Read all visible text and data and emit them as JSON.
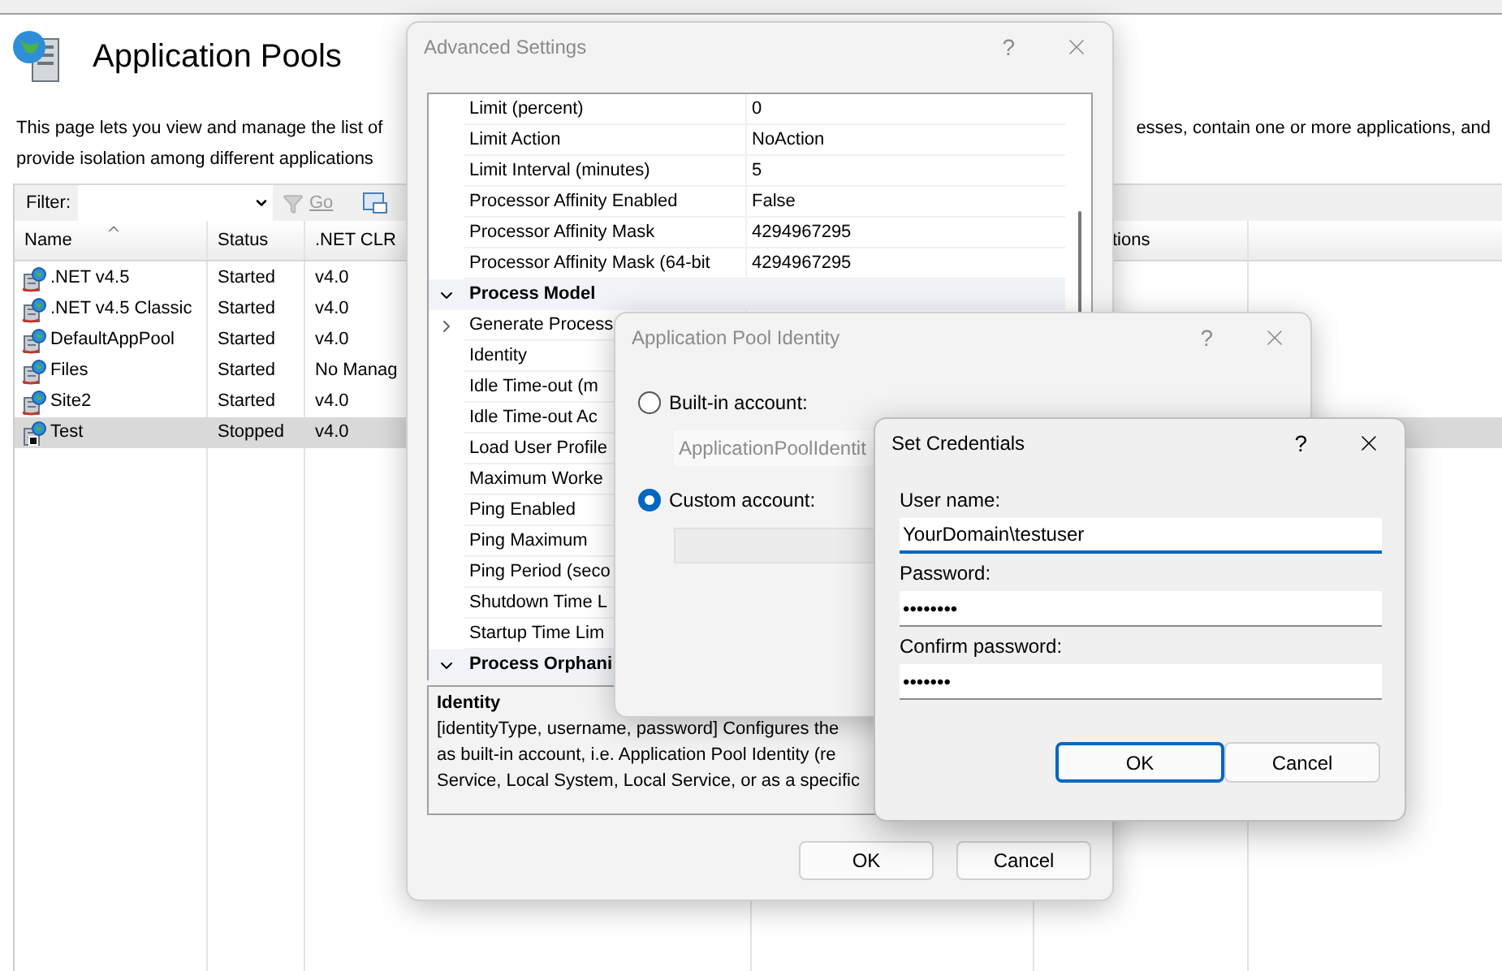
{
  "page": {
    "title": "Application Pools",
    "description": [
      "This page lets you view and manage the list of",
      "provide isolation among different applications"
    ],
    "description_right": "esses, contain one or more applications, and"
  },
  "toolbar": {
    "filter_label": "Filter:",
    "go": "Go"
  },
  "table": {
    "columns": [
      "Name",
      "Status",
      ".NET CLR"
    ],
    "column_right": "tions",
    "rows": [
      {
        "name": ".NET v4.5",
        "status": "Started",
        "clr": "v4.0",
        "kind": "started",
        "selected": false
      },
      {
        "name": ".NET v4.5 Classic",
        "status": "Started",
        "clr": "v4.0",
        "kind": "started",
        "selected": false
      },
      {
        "name": "DefaultAppPool",
        "status": "Started",
        "clr": "v4.0",
        "kind": "started",
        "selected": false
      },
      {
        "name": "Files",
        "status": "Started",
        "clr": "No Manag",
        "kind": "started",
        "selected": false
      },
      {
        "name": "Site2",
        "status": "Started",
        "clr": "v4.0",
        "kind": "started",
        "selected": false
      },
      {
        "name": "Test",
        "status": "Stopped",
        "clr": "v4.0",
        "kind": "stopped",
        "selected": true
      }
    ]
  },
  "advanced": {
    "title": "Advanced Settings",
    "help": "?",
    "rows": [
      {
        "kind": "property",
        "name": "Limit (percent)",
        "value": "0"
      },
      {
        "kind": "property",
        "name": "Limit Action",
        "value": "NoAction"
      },
      {
        "kind": "property",
        "name": "Limit Interval (minutes)",
        "value": "5"
      },
      {
        "kind": "property",
        "name": "Processor Affinity Enabled",
        "value": "False"
      },
      {
        "kind": "property",
        "name": "Processor Affinity Mask",
        "value": "4294967295"
      },
      {
        "kind": "property",
        "name": "Processor Affinity Mask (64-bit",
        "value": "4294967295"
      },
      {
        "kind": "category",
        "name": "Process Model",
        "expanded": true
      },
      {
        "kind": "property",
        "name": "Generate Process",
        "expanded": false
      },
      {
        "kind": "property",
        "name": "Identity"
      },
      {
        "kind": "property",
        "name": "Idle Time-out (m"
      },
      {
        "kind": "property",
        "name": "Idle Time-out Ac"
      },
      {
        "kind": "property",
        "name": "Load User Profile"
      },
      {
        "kind": "property",
        "name": "Maximum Worke"
      },
      {
        "kind": "property",
        "name": "Ping Enabled"
      },
      {
        "kind": "property",
        "name": "Ping Maximum"
      },
      {
        "kind": "property",
        "name": "Ping Period (seco"
      },
      {
        "kind": "property",
        "name": "Shutdown Time L"
      },
      {
        "kind": "property",
        "name": "Startup Time Lim"
      },
      {
        "kind": "category",
        "name": "Process Orphani",
        "expanded": true
      }
    ],
    "description": {
      "title": "Identity",
      "lines": [
        "[identityType, username, password] Configures the",
        "as built-in account, i.e. Application Pool Identity (re",
        "Service, Local System, Local Service, or as a specific"
      ]
    },
    "buttons": [
      "OK",
      "Cancel"
    ]
  },
  "identity": {
    "title": "Application Pool Identity",
    "help": "?",
    "options": [
      {
        "label": "Built-in account:",
        "selected": false,
        "field_value": "ApplicationPoolIdentit"
      },
      {
        "label": "Custom account:",
        "selected": true
      }
    ]
  },
  "credentials": {
    "title": "Set Credentials",
    "help": "?",
    "fields": [
      {
        "label": "User name:",
        "value": "YourDomain\\testuser",
        "focused": true
      },
      {
        "label": "Password:",
        "value": "••••••••",
        "focused": false
      },
      {
        "label": "Confirm password:",
        "value": "•••••••",
        "focused": false
      }
    ],
    "buttons": [
      {
        "label": "OK",
        "default": true
      },
      {
        "label": "Cancel",
        "default": false
      }
    ]
  }
}
